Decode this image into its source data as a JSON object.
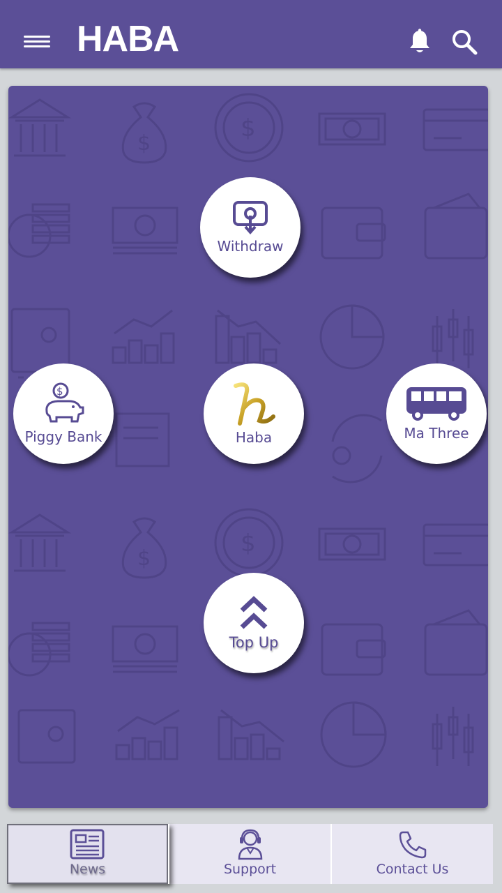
{
  "header": {
    "title": "HABA",
    "menu_icon": "hamburger-menu-icon",
    "notification_icon": "bell-icon",
    "search_icon": "search-icon",
    "background_color": "#5b4f97"
  },
  "actions": {
    "withdraw": {
      "label": "Withdraw",
      "icon": "atm-withdraw-icon"
    },
    "piggy_bank": {
      "label": "Piggy Bank",
      "icon": "piggy-bank-icon"
    },
    "haba": {
      "label": "Haba",
      "icon": "haba-gold-logo"
    },
    "ma_three": {
      "label": "Ma Three",
      "icon": "bus-icon"
    },
    "top_up": {
      "label": "Top Up",
      "icon": "double-chevron-up-icon"
    }
  },
  "bottom_nav": {
    "items": [
      {
        "label": "News",
        "icon": "newspaper-icon",
        "active": true
      },
      {
        "label": "Support",
        "icon": "support-agent-icon",
        "active": false
      },
      {
        "label": "Contact Us",
        "icon": "phone-icon",
        "active": false
      }
    ]
  },
  "colors": {
    "accent": "#5b4f97",
    "gold": "#d4af37",
    "nav_bg": "#e8e6f2"
  }
}
